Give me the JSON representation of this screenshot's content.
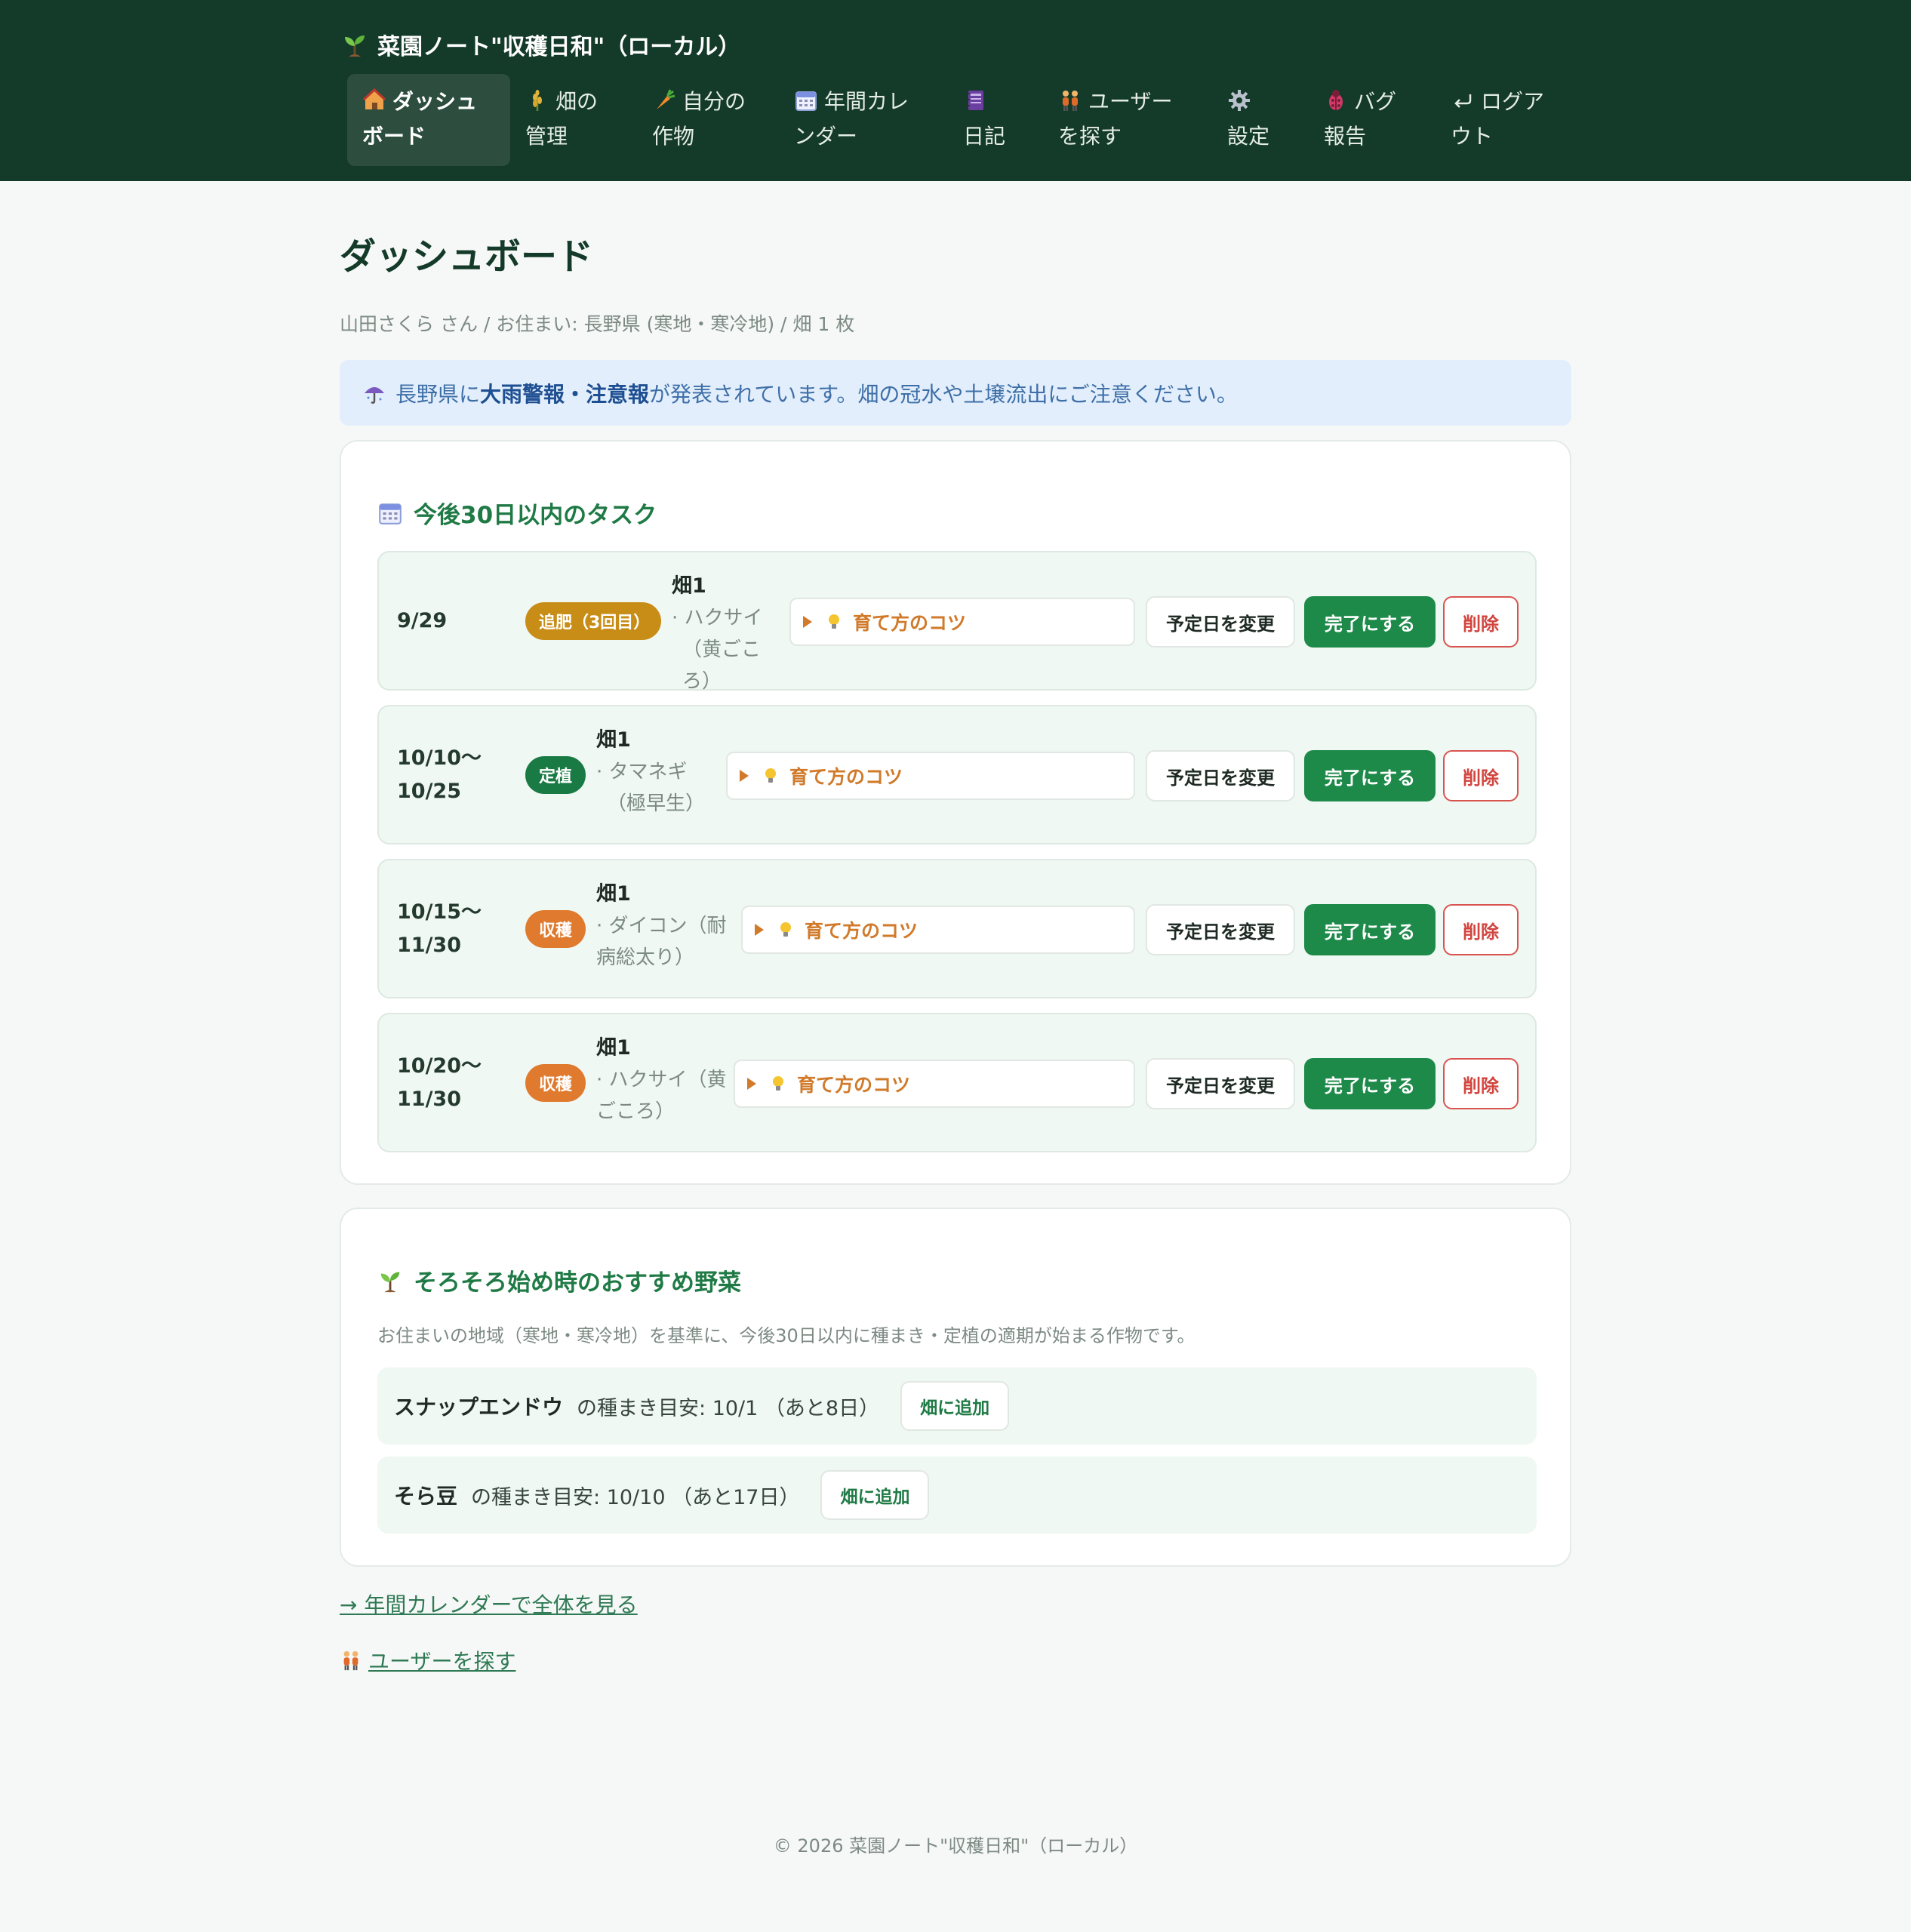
{
  "header": {
    "brand_icon": "seedling-icon",
    "brand": "菜園ノート\"収穫日和\"（ローカル）",
    "nav": [
      {
        "icon": "house-icon",
        "line1": "ダッシュ",
        "line2": "ボード",
        "active": true
      },
      {
        "icon": "grain-icon",
        "line1": "畑の",
        "line2": "管理"
      },
      {
        "icon": "carrot-icon",
        "line1": "自分の",
        "line2": "作物"
      },
      {
        "icon": "calendar-icon",
        "line1": "年間カレ",
        "line2": "ンダー"
      },
      {
        "icon": "notebook-icon",
        "line1": "",
        "line2": "日記"
      },
      {
        "icon": "people-icon",
        "line1": "ユーザー",
        "line2": "を探す"
      },
      {
        "icon": "gear-icon",
        "line1": "",
        "line2": "設定"
      },
      {
        "icon": "bug-icon",
        "line1": "バグ",
        "line2": "報告"
      },
      {
        "icon": "return-icon",
        "line1": "ログア",
        "line2": "ウト"
      }
    ]
  },
  "page": {
    "title": "ダッシュボード",
    "user_info": "山田さくら さん / お住まい: 長野県 (寒地・寒冷地) / 畑 1 枚"
  },
  "alert": {
    "icon": "umbrella-icon",
    "prefix": "長野県に",
    "strong": "大雨警報・注意報",
    "suffix": "が発表されています。畑の冠水や土壌流出にご注意ください。"
  },
  "tasks": {
    "icon": "calendar-icon",
    "title": "今後30日以内のタスク",
    "tips_label": "育て方のコツ",
    "change_label": "予定日を変更",
    "done_label": "完了にする",
    "delete_label": "削除",
    "items": [
      {
        "date1": "9/29",
        "date2": "",
        "badge": "追肥（3回目）",
        "badge_type": "tsuihi",
        "field": "畑1",
        "crop_l1": "· ハクサイ",
        "crop_l2": "（黄ごころ）"
      },
      {
        "date1": "10/10〜",
        "date2": "10/25",
        "badge": "定植",
        "badge_type": "teishoku",
        "field": "畑1",
        "crop_l1": "· タマネギ",
        "crop_l2": "（極早生）"
      },
      {
        "date1": "10/15〜",
        "date2": "11/30",
        "badge": "収穫",
        "badge_type": "shukaku",
        "field": "畑1",
        "crop_l1": "· ダイコン（耐",
        "crop_l2": "病総太り）"
      },
      {
        "date1": "10/20〜",
        "date2": "11/30",
        "badge": "収穫",
        "badge_type": "shukaku",
        "field": "畑1",
        "crop_l1": "· ハクサイ（黄",
        "crop_l2": "ごころ）"
      }
    ]
  },
  "recommend": {
    "icon": "seedling-icon",
    "title": "そろそろ始め時のおすすめ野菜",
    "desc": "お住まいの地域（寒地・寒冷地）を基準に、今後30日以内に種まき・定植の適期が始まる作物です。",
    "add_label": "畑に追加",
    "items": [
      {
        "name": "スナップエンドウ",
        "info": "の種まき目安: 10/1 （あと8日）"
      },
      {
        "name": "そら豆",
        "info": "の種まき目安: 10/10 （あと17日）"
      }
    ]
  },
  "links": {
    "calendar": "→ 年間カレンダーで全体を見る",
    "users_icon": "people-icon",
    "users": "ユーザーを探す"
  },
  "footer": "© 2026 菜園ノート\"収穫日和\"（ローカル）",
  "colors": {
    "header_bg": "#143a29",
    "accent_green": "#1e8a4a",
    "badge_tsuihi": "#c88d17",
    "badge_teishoku": "#1a7a44",
    "badge_shukaku": "#e07a2e",
    "alert_bg": "#e2eefb",
    "delete_red": "#d2453f"
  }
}
